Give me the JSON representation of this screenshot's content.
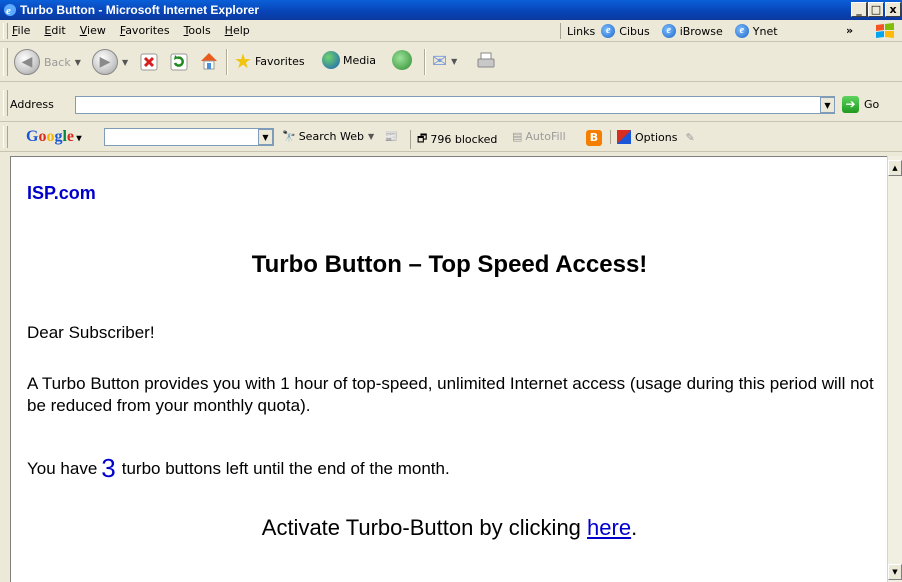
{
  "window": {
    "title": "Turbo Button - Microsoft Internet Explorer"
  },
  "menubar": {
    "items": [
      "File",
      "Edit",
      "View",
      "Favorites",
      "Tools",
      "Help"
    ],
    "links_label": "Links",
    "links": [
      "Cibus",
      "iBrowse",
      "Ynet"
    ],
    "chevron": "»"
  },
  "toolbar": {
    "back_label": "Back",
    "favorites_label": "Favorites",
    "media_label": "Media"
  },
  "address_bar": {
    "label": "Address",
    "value": "",
    "go_label": "Go"
  },
  "google_bar": {
    "logo": "Google",
    "search_web_label": "Search Web",
    "blocked_label": "796 blocked",
    "autofill_label": "AutoFill",
    "options_label": "Options"
  },
  "content": {
    "brand": "ISP.com",
    "headline": "Turbo Button – Top Speed Access!",
    "greeting": "Dear Subscriber!",
    "paragraph": "A Turbo Button provides you with 1 hour of top-speed, unlimited Internet access (usage during this period will not be reduced from your monthly quota).",
    "remaining_prefix": "You have",
    "remaining_count": "3",
    "remaining_suffix": "turbo buttons left until the end of the month.",
    "activate_prefix": "Activate Turbo-Button by clicking",
    "activate_link": "here",
    "activate_suffix": "."
  },
  "colors": {
    "link": "#0000cc",
    "titlebar": "#0843b6",
    "chrome": "#ece9d8"
  }
}
